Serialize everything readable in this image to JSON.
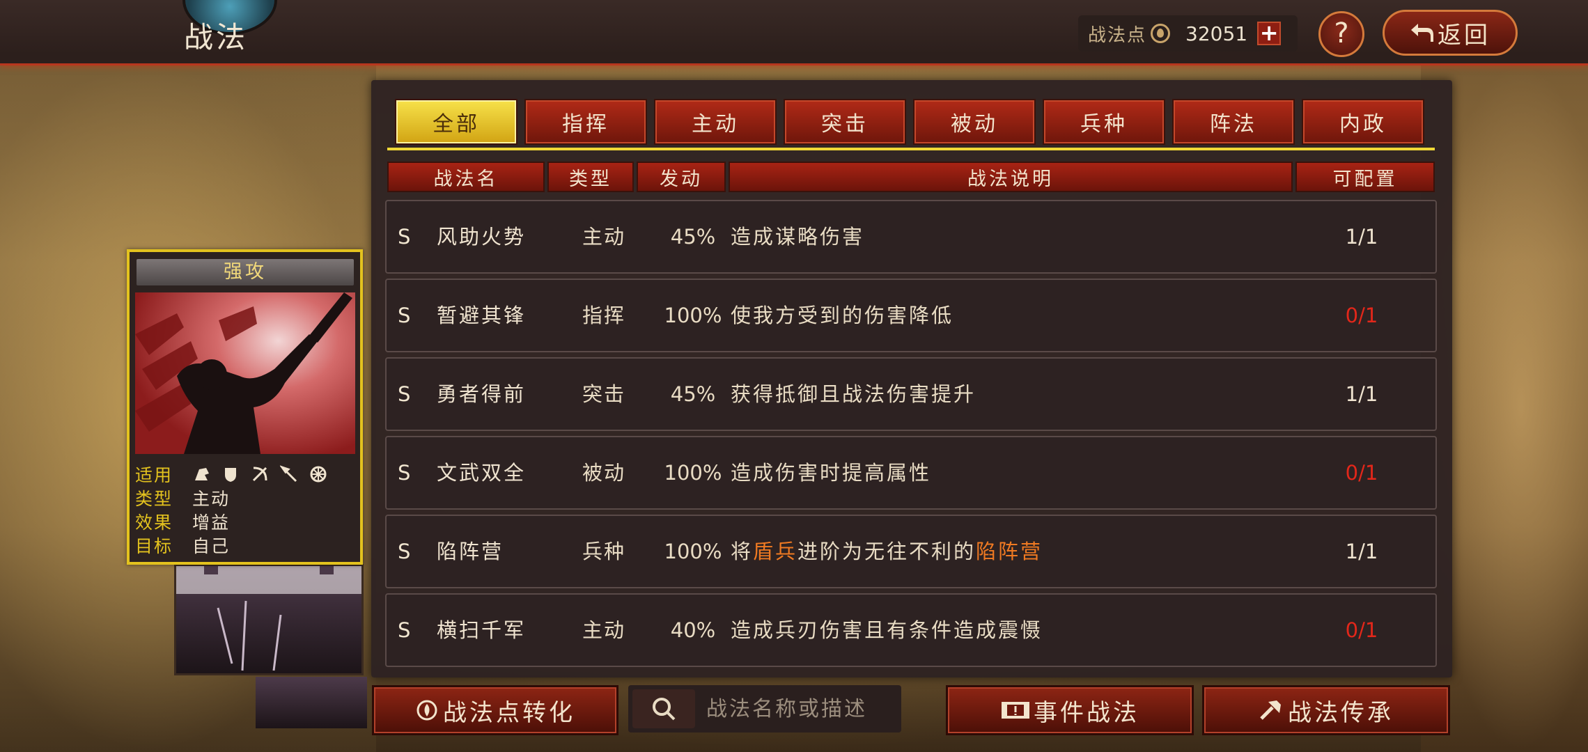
{
  "header": {
    "title": "战法",
    "points_label": "战法点",
    "points_value": "32051",
    "plus_label": "+",
    "help_label": "?",
    "back_label": "返回"
  },
  "tabs": [
    "全部",
    "指挥",
    "主动",
    "突击",
    "被动",
    "兵种",
    "阵法",
    "内政"
  ],
  "active_tab": "全部",
  "columns": [
    "战法名",
    "类型",
    "发动",
    "战法说明",
    "可配置"
  ],
  "rows": [
    {
      "grade": "S",
      "name": "风助火势",
      "type": "主动",
      "rate": "45%",
      "desc": "造成谋略伤害",
      "slots": "1/1",
      "full": false
    },
    {
      "grade": "S",
      "name": "暂避其锋",
      "type": "指挥",
      "rate": "100%",
      "desc": "使我方受到的伤害降低",
      "slots": "0/1",
      "full": true
    },
    {
      "grade": "S",
      "name": "勇者得前",
      "type": "突击",
      "rate": "45%",
      "desc": "获得抵御且战法伤害提升",
      "slots": "1/1",
      "full": false
    },
    {
      "grade": "S",
      "name": "文武双全",
      "type": "被动",
      "rate": "100%",
      "desc": "造成伤害时提高属性",
      "slots": "0/1",
      "full": true
    },
    {
      "grade": "S",
      "name": "陷阵营",
      "type": "兵种",
      "rate": "100%",
      "desc_parts": [
        "将",
        "盾兵",
        "进阶为无往不利的",
        "陷阵营"
      ],
      "slots": "1/1",
      "full": false
    },
    {
      "grade": "S",
      "name": "横扫千军",
      "type": "主动",
      "rate": "40%",
      "desc": "造成兵刃伤害且有条件造成震慑",
      "slots": "0/1",
      "full": true
    }
  ],
  "card": {
    "title": "强攻",
    "labels": {
      "applicable": "适用",
      "type": "类型",
      "effect": "效果",
      "target": "目标"
    },
    "type": "主动",
    "effect": "增益",
    "target": "自己",
    "troop_icons": [
      "cavalry-icon",
      "shield-icon",
      "bow-icon",
      "spear-icon",
      "chariot-icon"
    ]
  },
  "bottom": {
    "convert_label": "战法点转化",
    "search_placeholder": "战法名称或描述",
    "event_label": "事件战法",
    "inherit_label": "战法传承"
  },
  "colors": {
    "accent_gold": "#f0d836",
    "tab_red": "#a82314",
    "unavailable_red": "#e2271a",
    "highlight_orange": "#f07a22"
  }
}
